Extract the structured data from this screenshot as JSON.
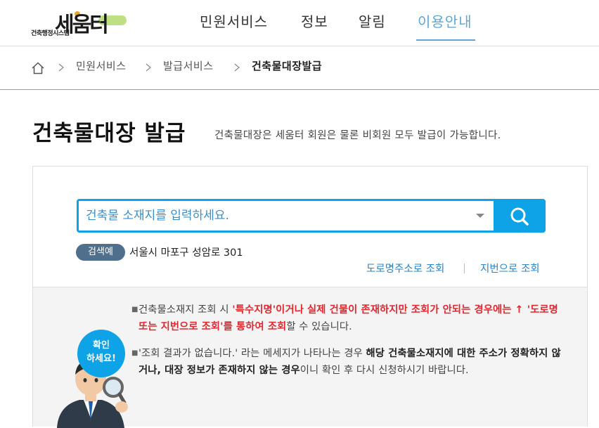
{
  "header": {
    "logo_main": "세움터",
    "logo_sub": "건축행정시스템",
    "nav": [
      {
        "label": "민원서비스"
      },
      {
        "label": "정보"
      },
      {
        "label": "알림"
      },
      {
        "label": "이용안내",
        "active": true
      }
    ],
    "accent_color": "#5ea7d6"
  },
  "breadcrumb": {
    "items": [
      "민원서비스",
      "발급서비스",
      "건축물대장발급"
    ]
  },
  "page": {
    "title": "건축물대장 발급",
    "description": "건축물대장은 세움터 회원은 물론 비회원 모두 발급이 가능합니다."
  },
  "search": {
    "placeholder": "건축물 소재지를 입력하세요.",
    "button_icon": "search-icon",
    "example_badge": "검색예",
    "example_text": "서울시 마포구 성암로 301",
    "link_road": "도로명주소로 조회",
    "link_lot": "지번으로 조회",
    "accent_color": "#0ea2e6"
  },
  "info": {
    "bubble_line1": "확인",
    "bubble_line2": "하세요!",
    "item1": {
      "a": "건축물소재지 조회 시 ",
      "b": "'특수지명'이거나 실제 건물이 존재하지만 조회가 안되는 경우에는 ↑ '도로명 또는 지번으로 조회'를 통하여 조회",
      "c": "할 수 있습니다."
    },
    "item2": {
      "a": "'조회 결과가 없습니다.' 라는 메세지가 나타나는 경우 ",
      "b": "해당 건축물소재지에 대한 주소가 정확하지 않거나, 대장 정보가 존재하지 않는 경우",
      "c": "이니 확인 후 다시 신청하시기 바랍니다."
    },
    "highlight_color": "#e0282e"
  }
}
